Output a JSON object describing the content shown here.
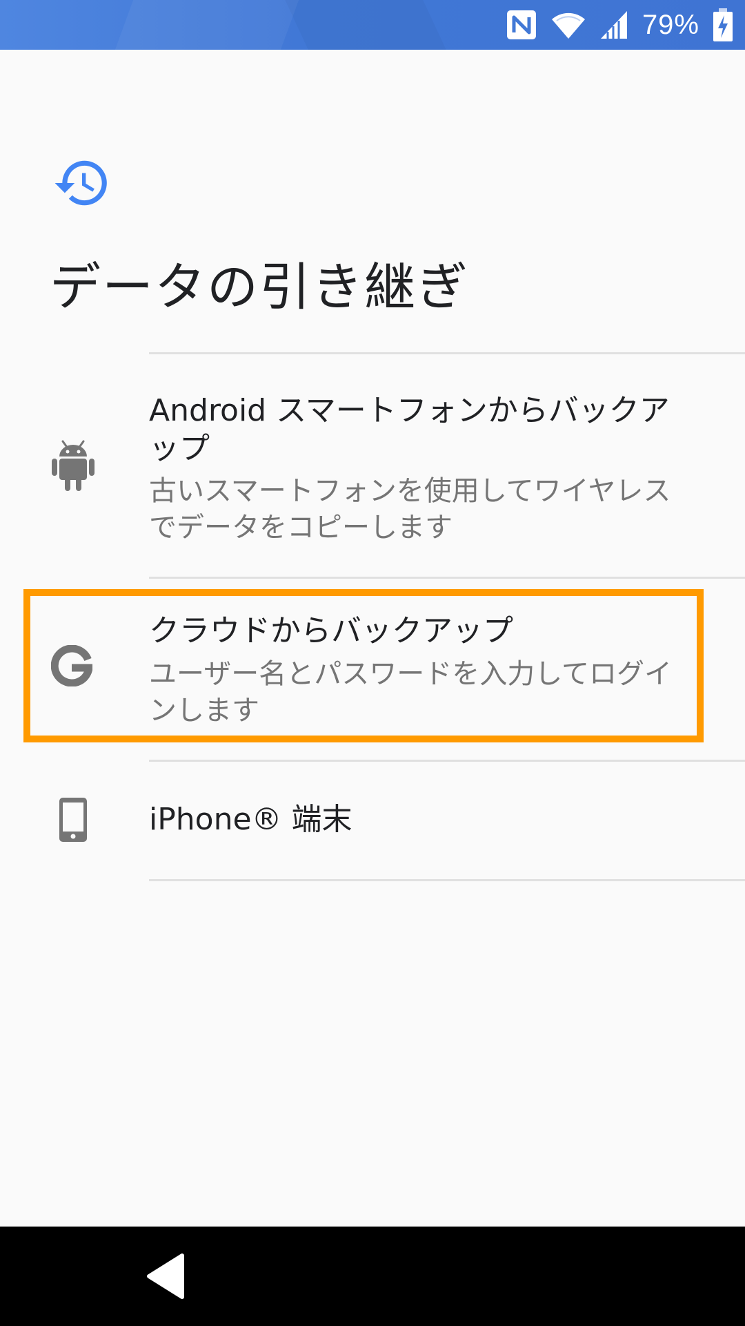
{
  "status_bar": {
    "battery_percent": "79%",
    "icons": [
      "nfc-icon",
      "wifi-icon",
      "signal-icon",
      "battery-charging-icon"
    ]
  },
  "header": {
    "icon": "restore-history-icon",
    "title": "データの引き継ぎ"
  },
  "options": [
    {
      "icon": "android-icon",
      "title": "Android スマートフォンからバックアップ",
      "subtitle": "古いスマートフォンを使用してワイヤレスでデータをコピーします"
    },
    {
      "icon": "google-icon",
      "title": "クラウドからバックアップ",
      "subtitle": "ユーザー名とパスワードを入力してログインします",
      "highlighted": true
    },
    {
      "icon": "smartphone-icon",
      "title": "iPhone® 端末",
      "subtitle": ""
    }
  ],
  "colors": {
    "accent": "#4285f4",
    "highlight": "#ff9a00",
    "title_text": "#202124",
    "secondary_text": "#757575",
    "icon_gray": "#757575"
  },
  "nav_bar": {
    "icons": [
      "back-icon"
    ]
  }
}
